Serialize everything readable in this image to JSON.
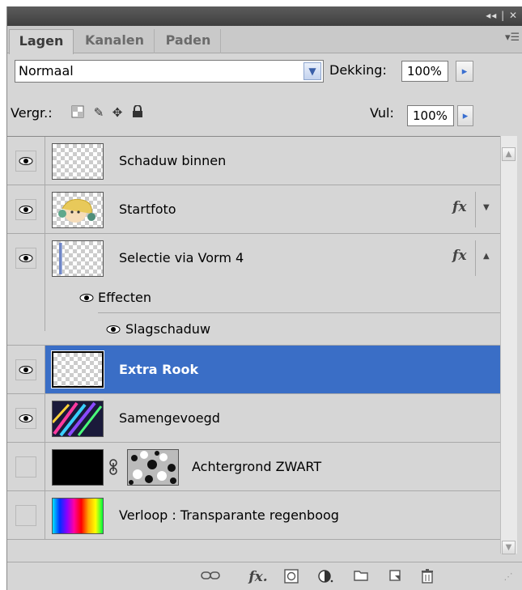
{
  "titlebar": {
    "controls": "◂◂ | ✕"
  },
  "tabs": [
    {
      "label": "Lagen"
    },
    {
      "label": "Kanalen"
    },
    {
      "label": "Paden"
    }
  ],
  "menu_icon": "▾☰",
  "blend_mode": {
    "value": "Normaal"
  },
  "opacity": {
    "label": "Dekking:",
    "value": "100%"
  },
  "lock": {
    "label": "Vergr.:",
    "icons": [
      "transparency-lock-icon",
      "brush-lock-icon",
      "move-lock-icon",
      "padlock-icon"
    ]
  },
  "fill": {
    "label": "Vul:",
    "value": "100%"
  },
  "layers": [
    {
      "name": "Schaduw binnen",
      "visible": true,
      "fx": false
    },
    {
      "name": "Startfoto",
      "visible": true,
      "fx": true,
      "fx_label": "fx",
      "expanded": false
    },
    {
      "name": "Selectie via Vorm 4",
      "visible": true,
      "fx": true,
      "fx_label": "fx",
      "expanded": true
    },
    {
      "name": "Effecten"
    },
    {
      "name": "Slagschaduw"
    },
    {
      "name": "Extra Rook",
      "visible": true,
      "selected": true
    },
    {
      "name": "Samengevoegd",
      "visible": true
    },
    {
      "name": "Achtergrond ZWART",
      "visible": false
    },
    {
      "name": "Verloop : Transparante regenboog",
      "visible": false
    }
  ],
  "colors": {
    "selected": "#3a6ec6",
    "panel": "#d6d6d6"
  }
}
